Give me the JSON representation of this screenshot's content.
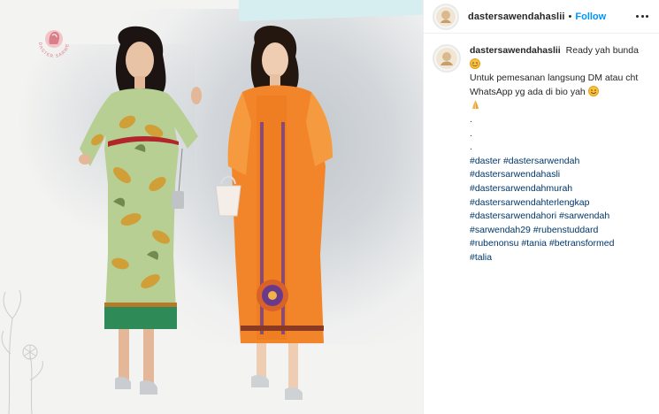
{
  "post": {
    "brand_logo_text": "DASTER SARWENDAH"
  },
  "header": {
    "username": "dastersawendahaslii",
    "separator": "•",
    "follow_label": "Follow"
  },
  "caption": {
    "username": "dastersawendahaslii",
    "line1": "Ready yah bunda",
    "line2": "Untuk pemesanan langsung DM atau cht WhatsApp yg ada di bio yah",
    "dots": [
      ".",
      ".",
      "."
    ],
    "hashtag_lines": [
      "#daster #dastersarwendah",
      "#dastersarwendahasli",
      "#dastersarwendahmurah",
      "#dastersarwendahterlengkap",
      "#dastersarwendahori #sarwendah",
      "#sarwendah29 #rubenstuddard",
      "#rubenonsu #tania #betransformed",
      "#talia"
    ]
  },
  "icons": {
    "more": "more-options-icon",
    "emoji1": "blush-emoji-icon",
    "emoji2": "smile-emoji-icon",
    "emoji3": "pray-emoji-icon"
  },
  "colors": {
    "follow": "#0095f6",
    "hashtag": "#00376b",
    "text": "#262626",
    "dress_left": "#a9c48a",
    "dress_right": "#f08a2a"
  }
}
